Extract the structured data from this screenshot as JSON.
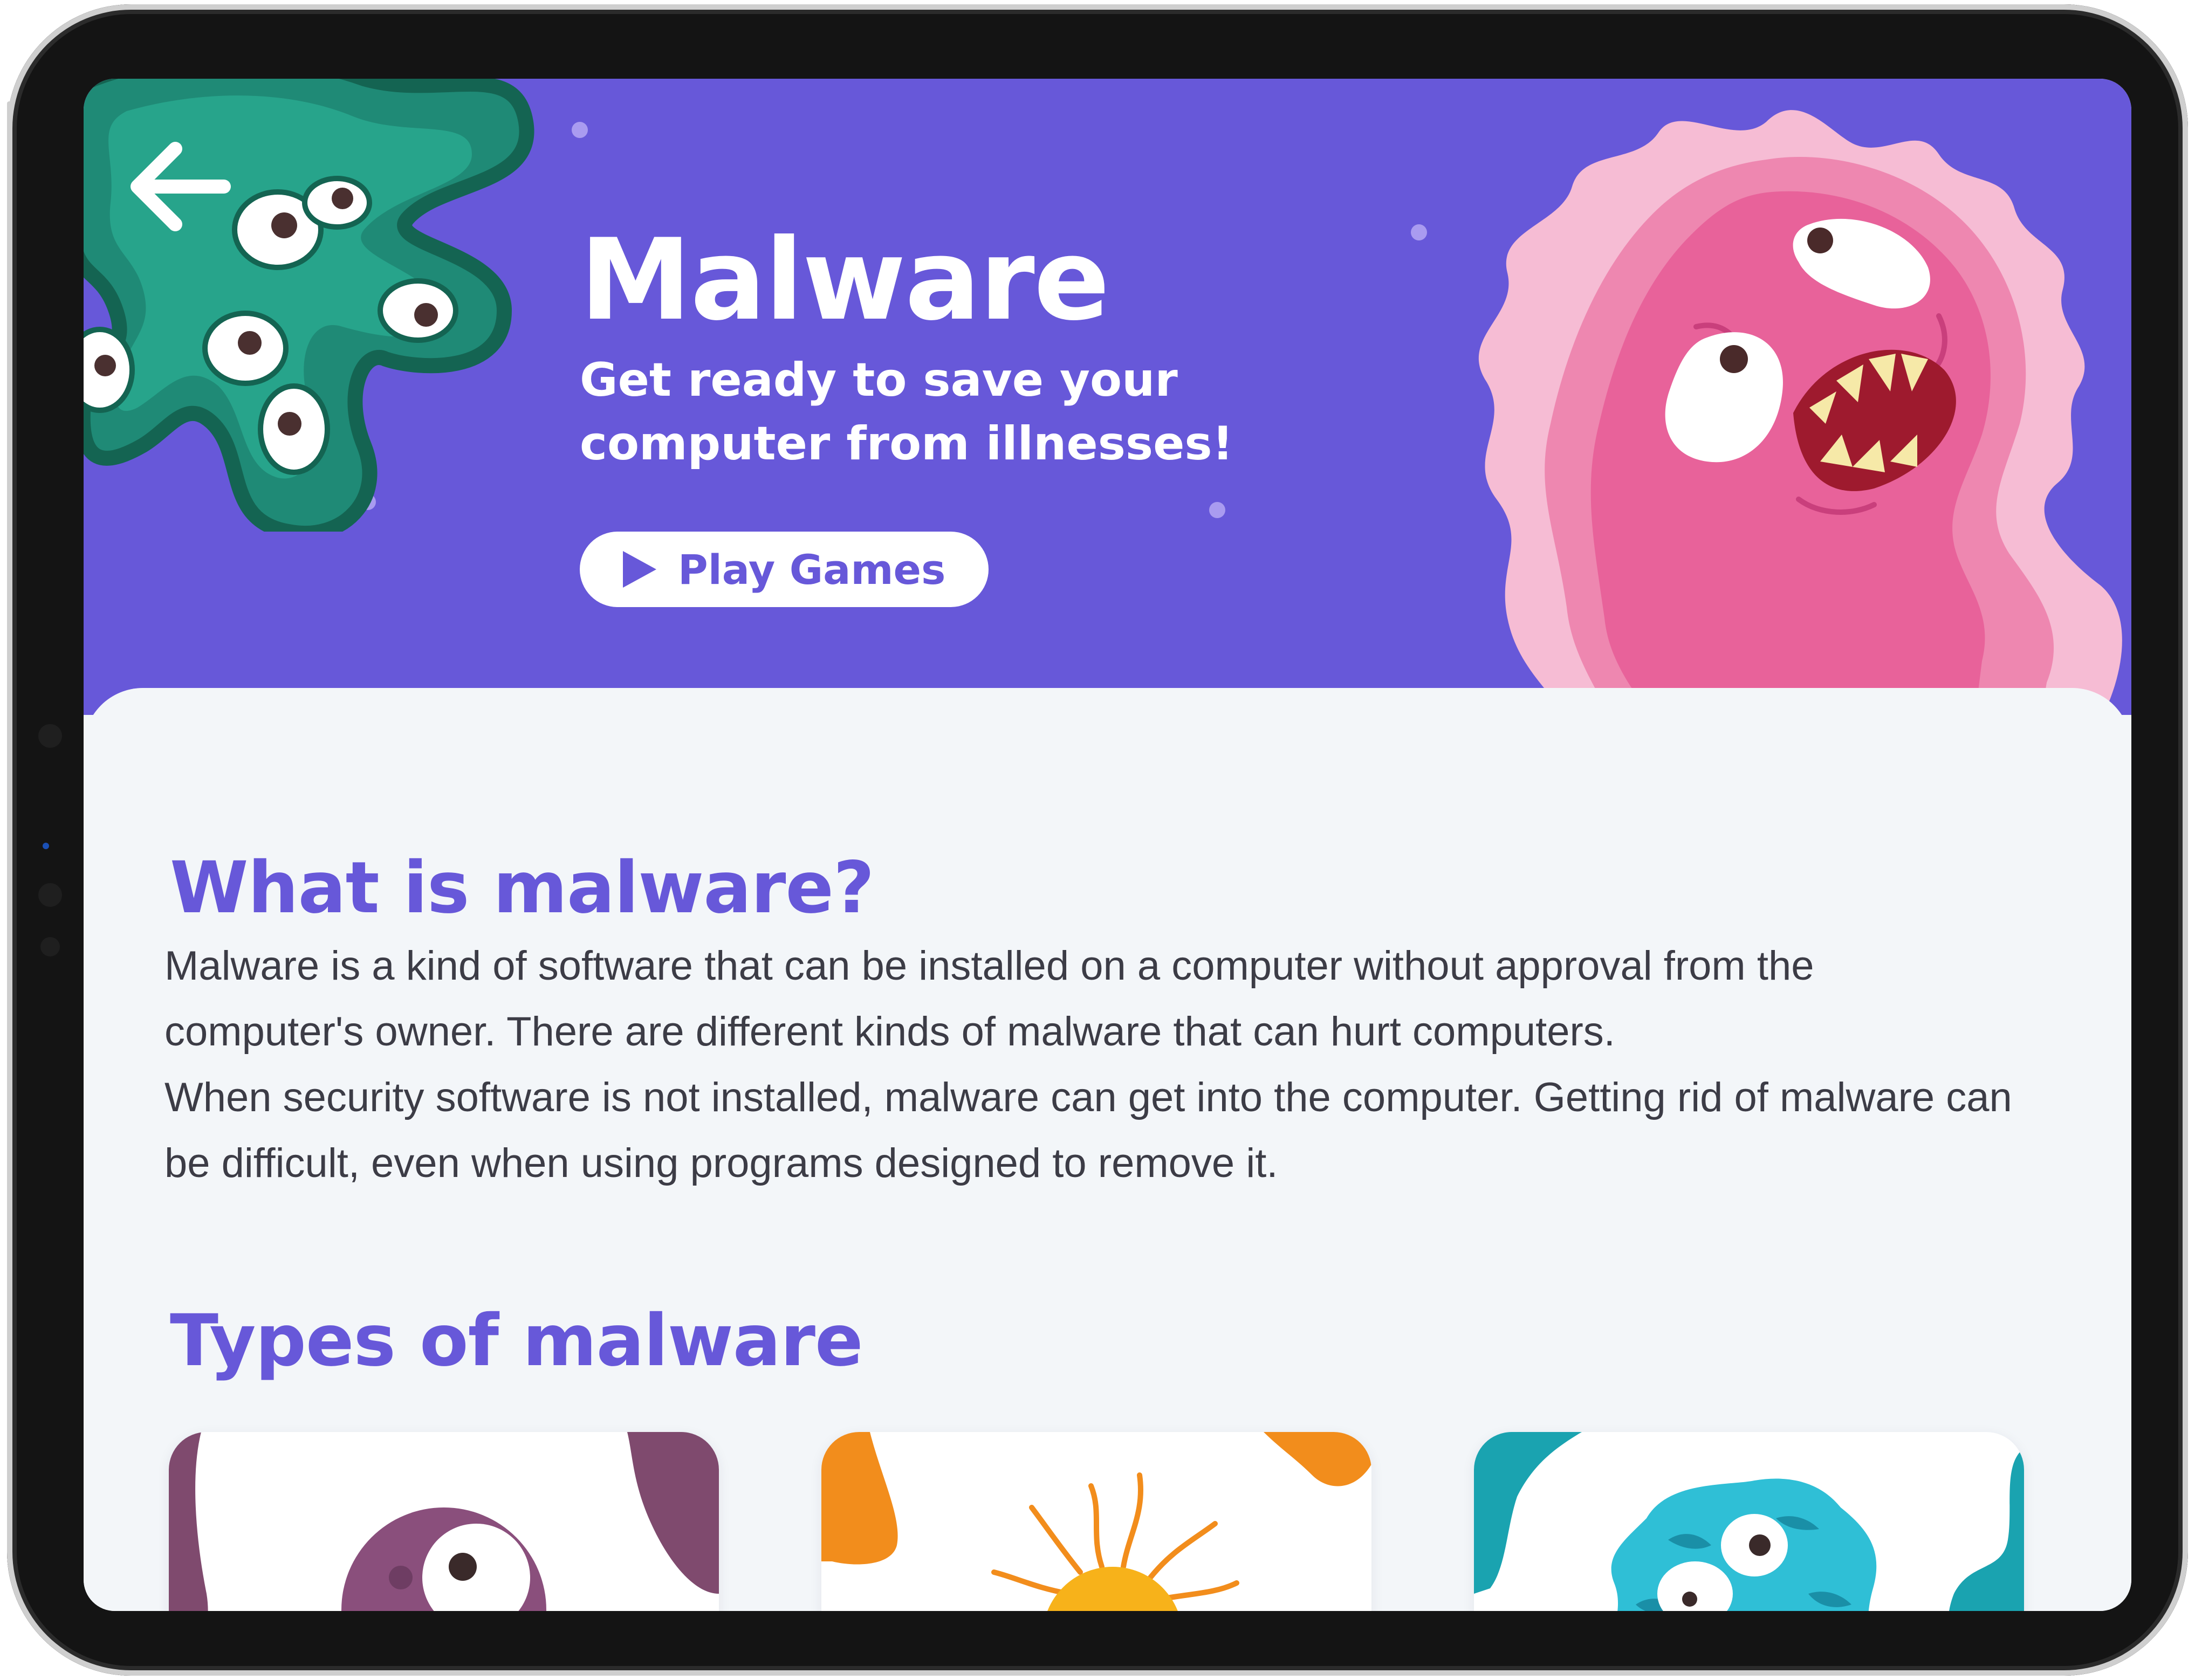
{
  "hero": {
    "title": "Malware",
    "subtitle": "Get ready to save your computer from illnesses!",
    "play_button": {
      "label": "Play Games",
      "icon": "play-icon"
    },
    "back_button": {
      "icon": "arrow-left-icon"
    },
    "background_color": "#6758d9"
  },
  "what_is": {
    "heading": "What is malware?",
    "paragraph_1": "Malware is a kind of software that can be installed on a computer without approval from the computer's owner. There are different kinds of malware that can hurt computers.",
    "paragraph_2": "When security software is not installed, malware can get into the computer. Getting rid of malware can be difficult, even when using programs designed to remove it."
  },
  "types": {
    "heading": "Types of malware",
    "cards": [
      {
        "accent": "#7f4a6e",
        "illustration": "purple-virus-illustration"
      },
      {
        "accent": "#f28d1c",
        "illustration": "orange-virus-illustration"
      },
      {
        "accent": "#1aa3b0",
        "illustration": "blue-virus-illustration"
      }
    ]
  },
  "colors": {
    "heading": "#6758d9",
    "body_text": "#3c3c46",
    "content_bg": "#f3f6f9"
  }
}
